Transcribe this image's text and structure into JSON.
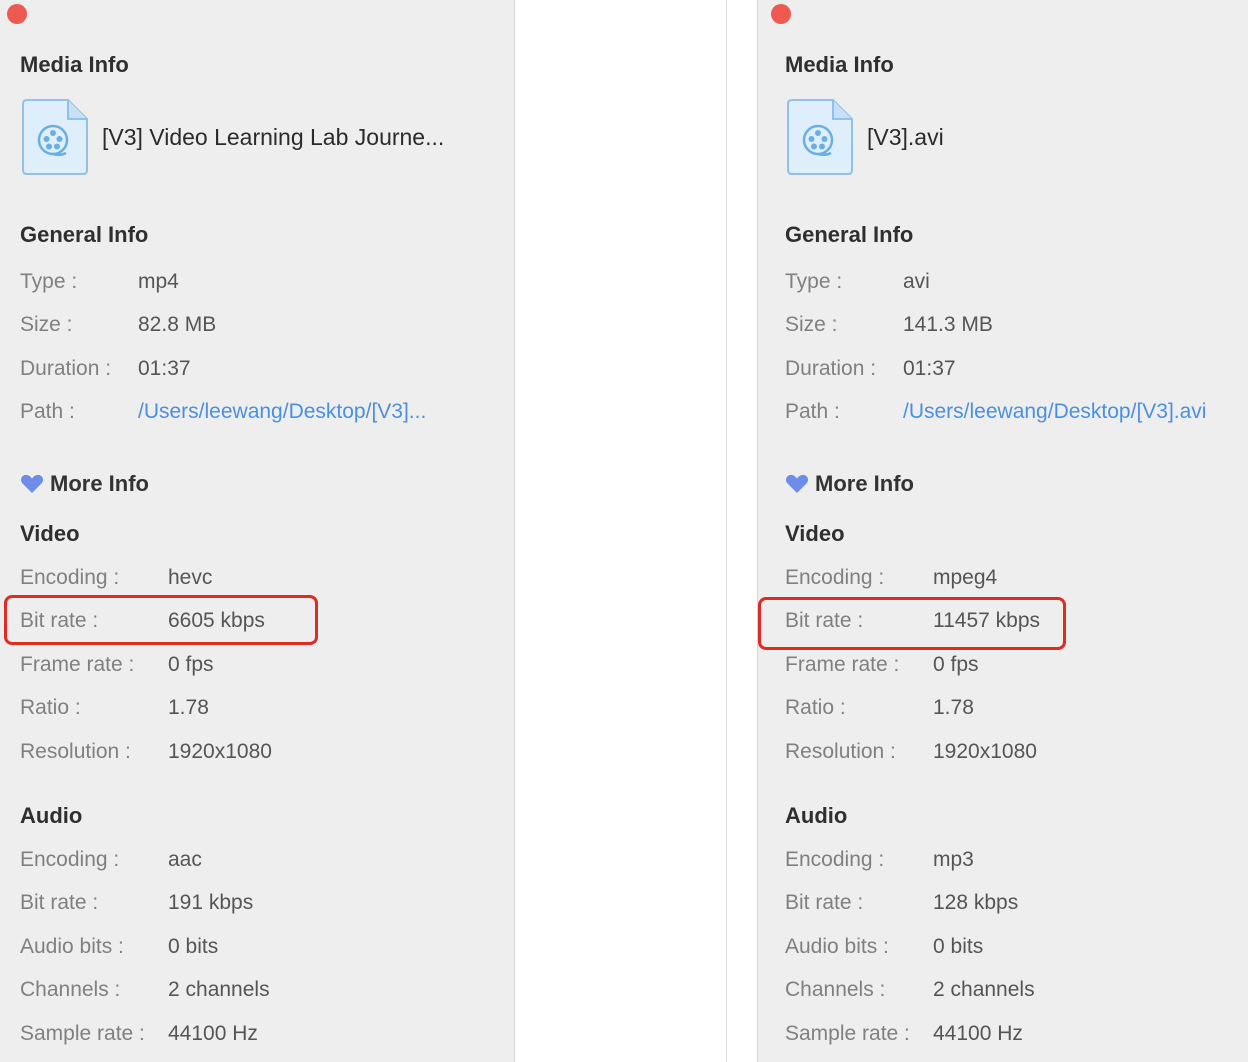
{
  "colors": {
    "close": "#ee5a52",
    "link": "#4a90e2",
    "highlight": "#e02b21",
    "heart": "#6d8de8",
    "panel_bg": "#efeeee"
  },
  "panels": [
    {
      "title": "Media Info",
      "file_icon": "video-file-icon",
      "file_name": "[V3] Video Learning Lab Journe...",
      "general_title": "General Info",
      "type_label": "Type :",
      "type_value": "mp4",
      "size_label": "Size :",
      "size_value": "82.8 MB",
      "duration_label": "Duration :",
      "duration_value": "01:37",
      "path_label": "Path :",
      "path_value": "/Users/leewang/Desktop/[V3]...",
      "more_info": "More Info",
      "more_info_icon": "heart-icon",
      "video_title": "Video",
      "video": {
        "encoding_label": "Encoding :",
        "encoding_value": "hevc",
        "bitrate_label": "Bit rate :",
        "bitrate_value": "6605 kbps",
        "framerate_label": "Frame rate :",
        "framerate_value": "0 fps",
        "ratio_label": "Ratio :",
        "ratio_value": "1.78",
        "resolution_label": "Resolution :",
        "resolution_value": "1920x1080"
      },
      "audio_title": "Audio",
      "audio": {
        "encoding_label": "Encoding :",
        "encoding_value": "aac",
        "bitrate_label": "Bit rate :",
        "bitrate_value": "191 kbps",
        "bits_label": "Audio bits :",
        "bits_value": "0 bits",
        "channels_label": "Channels :",
        "channels_value": "2 channels",
        "samplerate_label": "Sample rate :",
        "samplerate_value": "44100 Hz"
      }
    },
    {
      "title": "Media Info",
      "file_icon": "video-file-icon",
      "file_name": "[V3].avi",
      "general_title": "General Info",
      "type_label": "Type :",
      "type_value": "avi",
      "size_label": "Size :",
      "size_value": "141.3 MB",
      "duration_label": "Duration :",
      "duration_value": "01:37",
      "path_label": "Path :",
      "path_value": "/Users/leewang/Desktop/[V3].avi",
      "more_info": "More Info",
      "more_info_icon": "heart-icon",
      "video_title": "Video",
      "video": {
        "encoding_label": "Encoding :",
        "encoding_value": "mpeg4",
        "bitrate_label": "Bit rate :",
        "bitrate_value": "11457 kbps",
        "framerate_label": "Frame rate :",
        "framerate_value": "0 fps",
        "ratio_label": "Ratio :",
        "ratio_value": "1.78",
        "resolution_label": "Resolution :",
        "resolution_value": "1920x1080"
      },
      "audio_title": "Audio",
      "audio": {
        "encoding_label": "Encoding :",
        "encoding_value": "mp3",
        "bitrate_label": "Bit rate :",
        "bitrate_value": "128 kbps",
        "bits_label": "Audio bits :",
        "bits_value": "0 bits",
        "channels_label": "Channels :",
        "channels_value": "2 channels",
        "samplerate_label": "Sample rate :",
        "samplerate_value": "44100 Hz"
      }
    }
  ]
}
